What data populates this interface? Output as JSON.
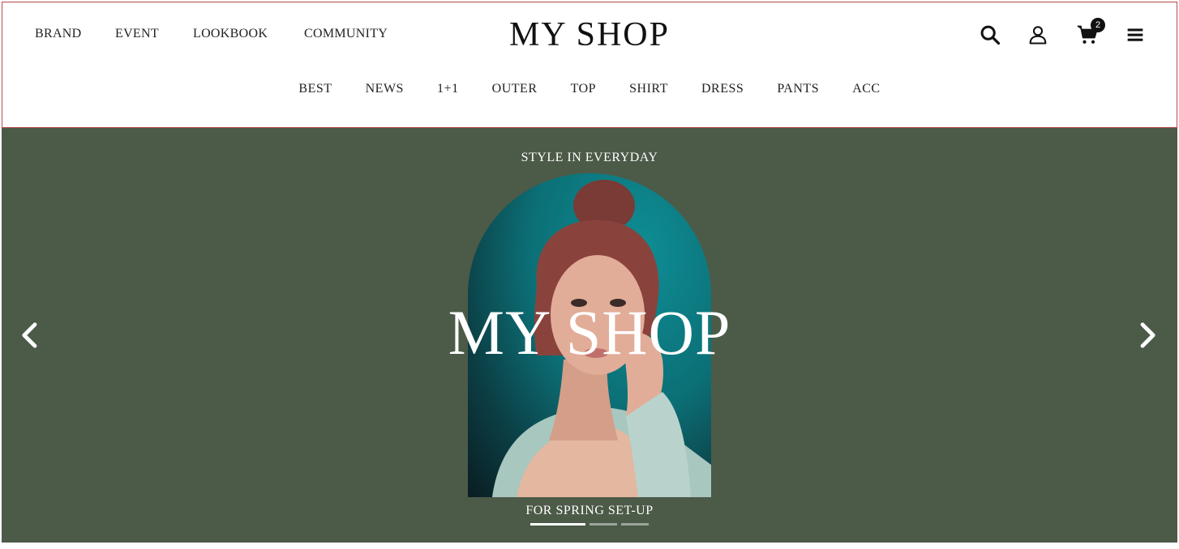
{
  "header": {
    "top_nav": [
      "BRAND",
      "EVENT",
      "LOOKBOOK",
      "COMMUNITY"
    ],
    "logo": "MY SHOP",
    "icons": [
      "search-icon",
      "user-icon",
      "cart-icon",
      "menu-icon"
    ],
    "cart_count": "2",
    "categories": [
      "BEST",
      "NEWS",
      "1+1",
      "OUTER",
      "TOP",
      "SHIRT",
      "DRESS",
      "PANTS",
      "ACC"
    ]
  },
  "hero": {
    "top_text": "STYLE IN EVERYDAY",
    "title": "MY SHOP",
    "bottom_text": "FOR SPRING SET-UP",
    "background_color": "#4c5a48",
    "slides_total": 3,
    "active_slide": 1,
    "prev_icon": "chevron-left-icon",
    "next_icon": "chevron-right-icon"
  },
  "colors": {
    "accent": "#111111",
    "header_border": "#b84a4a",
    "hero_bg": "#4c5a48",
    "photo_teal": "#0c6f76"
  }
}
